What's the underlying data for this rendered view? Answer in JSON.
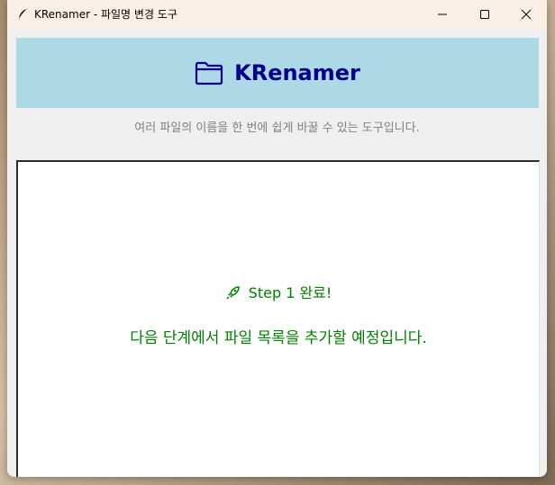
{
  "window": {
    "title": "KRenamer - 파일명 변경 도구",
    "app_icon": "feather-icon",
    "controls": [
      "minimize-icon",
      "maximize-icon",
      "close-icon"
    ]
  },
  "header": {
    "icon": "folder-icon",
    "title": "KRenamer",
    "background": "#add8e6",
    "title_color": "#00008b"
  },
  "subtitle": "여러 파일의 이름을 한 번에 쉽게 바꿀 수 있는 도구입니다.",
  "content": {
    "step_icon": "rocket-icon",
    "step_text": "Step 1 완료!",
    "next_text": "다음 단계에서 파일 목록을 추가할 예정입니다.",
    "text_color": "#008000"
  }
}
